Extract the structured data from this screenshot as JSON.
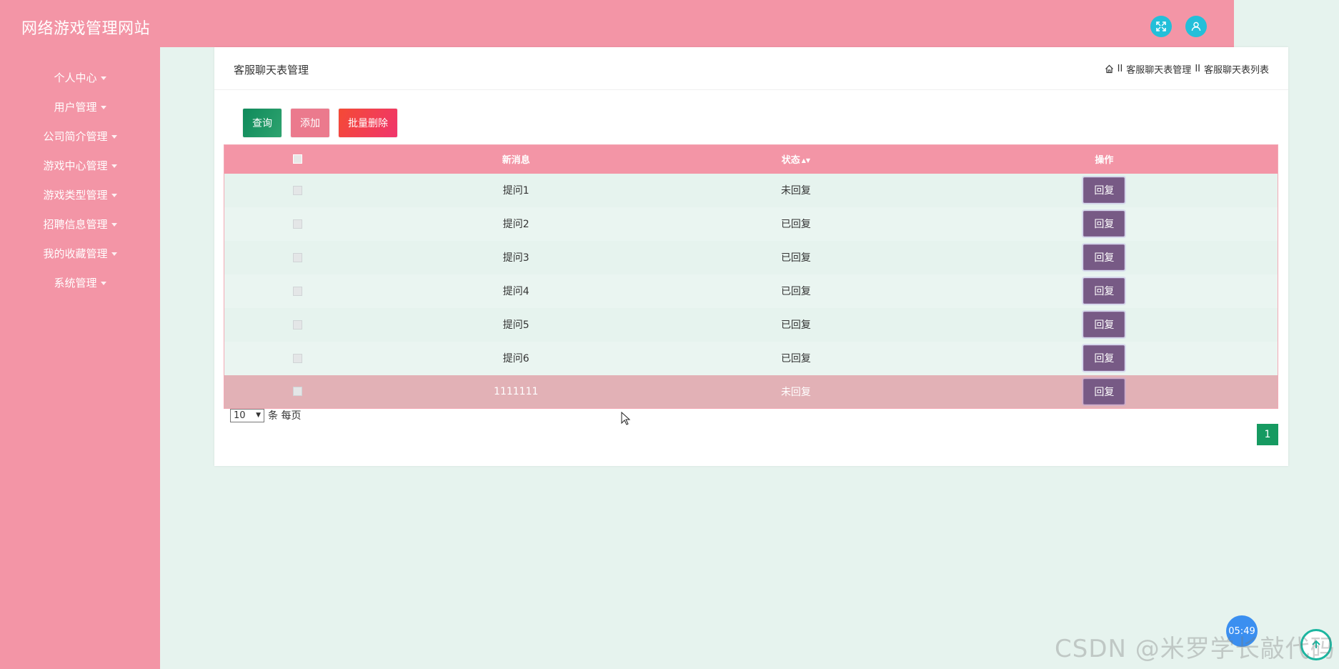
{
  "header": {
    "title": "网络游戏管理网站",
    "fullscreen_icon": "fullscreen-icon",
    "user_icon": "user-icon"
  },
  "sidebar": {
    "items": [
      {
        "label": "个人中心"
      },
      {
        "label": "用户管理"
      },
      {
        "label": "公司简介管理"
      },
      {
        "label": "游戏中心管理"
      },
      {
        "label": "游戏类型管理"
      },
      {
        "label": "招聘信息管理"
      },
      {
        "label": "我的收藏管理"
      },
      {
        "label": "系统管理"
      }
    ]
  },
  "page": {
    "heading": "客服聊天表管理",
    "breadcrumb": {
      "separator": "II",
      "crumb1": "客服聊天表管理",
      "crumb2": "客服聊天表列表"
    }
  },
  "toolbar": {
    "search_label": "查询",
    "add_label": "添加",
    "bulk_delete_label": "批量删除"
  },
  "table": {
    "columns": {
      "message": "新消息",
      "status": "状态",
      "operation": "操作"
    },
    "rows": [
      {
        "message": "提问1",
        "status": "未回复",
        "action": "回复"
      },
      {
        "message": "提问2",
        "status": "已回复",
        "action": "回复"
      },
      {
        "message": "提问3",
        "status": "已回复",
        "action": "回复"
      },
      {
        "message": "提问4",
        "status": "已回复",
        "action": "回复"
      },
      {
        "message": "提问5",
        "status": "已回复",
        "action": "回复"
      },
      {
        "message": "提问6",
        "status": "已回复",
        "action": "回复"
      },
      {
        "message": "1111111",
        "status": "未回复",
        "action": "回复"
      }
    ]
  },
  "pagination": {
    "page_size": "10",
    "page_size_suffix": "条 每页",
    "current_page": "1"
  },
  "overlay": {
    "clock": "05:49",
    "watermark": "CSDN @米罗学长敲代码"
  },
  "colors": {
    "accent": "#f395a6",
    "background": "#e6f3ee",
    "search_button": "#169a61",
    "add_button": "#eb7a8d",
    "delete_button": "#f44a35",
    "reply_button": "#775a85",
    "highlight_row": "#e2b1b6"
  }
}
